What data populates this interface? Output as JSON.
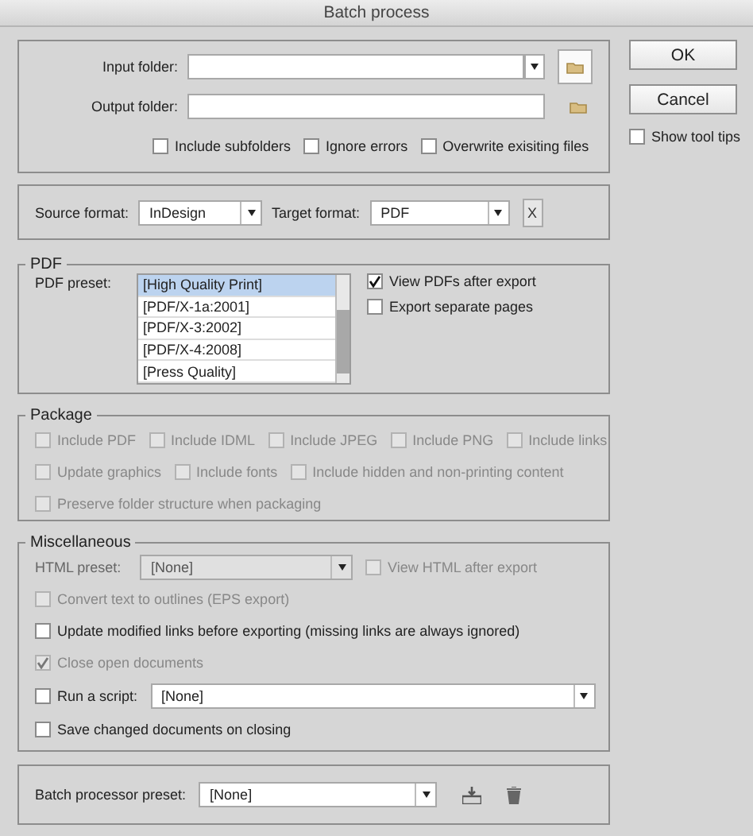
{
  "window": {
    "title": "Batch process"
  },
  "folders": {
    "input_label": "Input folder:",
    "output_label": "Output folder:",
    "options": [
      {
        "label": "Include subfolders",
        "checked": false
      },
      {
        "label": "Ignore errors",
        "checked": false
      },
      {
        "label": "Overwrite exisiting files",
        "checked": false
      }
    ]
  },
  "formats": {
    "source_label": "Source format:",
    "source_value": "InDesign",
    "target_label": "Target format:",
    "target_value": "PDF",
    "clear_button": "X"
  },
  "pdf": {
    "legend": "PDF",
    "preset_label": "PDF preset:",
    "presets": [
      {
        "label": "[High Quality Print]",
        "selected": true
      },
      {
        "label": "[PDF/X-1a:2001]",
        "selected": false
      },
      {
        "label": "[PDF/X-3:2002]",
        "selected": false
      },
      {
        "label": "[PDF/X-4:2008]",
        "selected": false
      },
      {
        "label": "[Press Quality]",
        "selected": false
      }
    ],
    "options": [
      {
        "label": "View PDFs after export",
        "checked": true
      },
      {
        "label": "Export separate pages",
        "checked": false
      }
    ]
  },
  "package": {
    "legend": "Package",
    "rows": [
      [
        {
          "label": "Include PDF",
          "checked": false,
          "disabled": true
        },
        {
          "label": "Include IDML",
          "checked": false,
          "disabled": true
        },
        {
          "label": "Include JPEG",
          "checked": false,
          "disabled": true
        },
        {
          "label": "Include PNG",
          "checked": false,
          "disabled": true
        },
        {
          "label": "Include links",
          "checked": false,
          "disabled": true
        }
      ],
      [
        {
          "label": "Update graphics",
          "checked": false,
          "disabled": true
        },
        {
          "label": "Include fonts",
          "checked": false,
          "disabled": true
        },
        {
          "label": "Include hidden and non-printing content",
          "checked": false,
          "disabled": true
        }
      ],
      [
        {
          "label": "Preserve folder structure when packaging",
          "checked": false,
          "disabled": true
        }
      ]
    ]
  },
  "misc": {
    "legend": "Miscellaneous",
    "items": [
      {
        "kind": "preset",
        "label": "HTML preset:",
        "value": "[None]",
        "disabled": true,
        "option": {
          "label": "View HTML after export",
          "checked": false,
          "disabled": true
        }
      },
      {
        "kind": "checkbox",
        "label": "Convert text to outlines (EPS export)",
        "checked": false,
        "disabled": true
      },
      {
        "kind": "checkbox",
        "label": "Update modified links before exporting (missing links are always ignored)",
        "checked": false,
        "disabled": false
      },
      {
        "kind": "checkbox",
        "label": "Close open documents",
        "checked": true,
        "disabled": true
      },
      {
        "kind": "script",
        "label": "Run a script:",
        "checked": false,
        "disabled": false,
        "value": "[None]"
      },
      {
        "kind": "checkbox",
        "label": "Save changed documents on closing",
        "checked": false,
        "disabled": false
      }
    ]
  },
  "batch_preset": {
    "label": "Batch processor preset:",
    "value": "[None]"
  },
  "buttons": [
    {
      "label": "OK"
    },
    {
      "label": "Cancel"
    }
  ],
  "show_tool_tips": {
    "label": "Show tool tips",
    "checked": false
  }
}
